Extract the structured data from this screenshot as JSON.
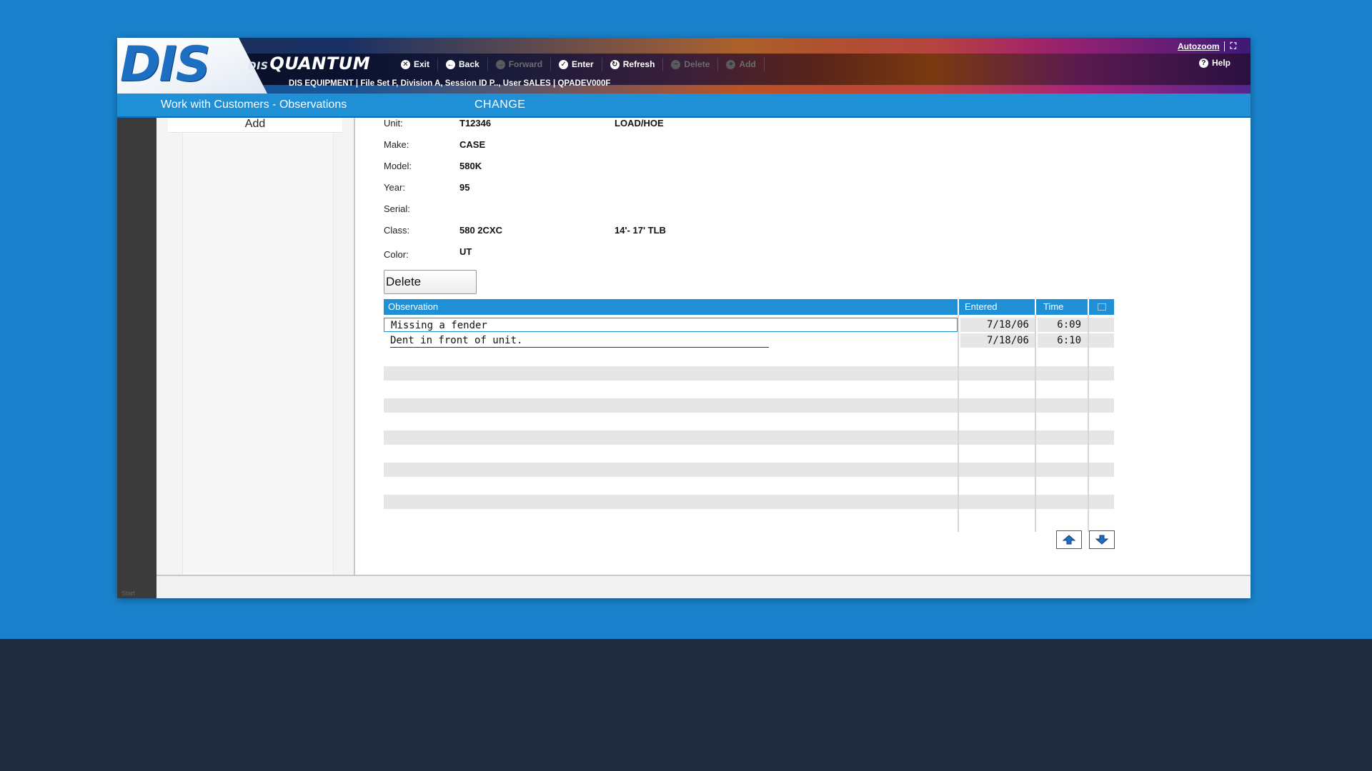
{
  "app": {
    "logo": "DIS",
    "brand_prefix": "DIS",
    "brand_name": "QUANTUM",
    "info_line": "DIS EQUIPMENT | File Set F, Division A, Session ID P.., User SALES | QPADEV000F",
    "autozoom_label": "Autozoom",
    "help_label": "Help"
  },
  "toolbar": [
    {
      "label": "Exit",
      "icon": "x-circle-icon",
      "glyph": "✕",
      "enabled": true
    },
    {
      "label": "Back",
      "icon": "back-icon",
      "glyph": "←",
      "enabled": true
    },
    {
      "label": "Forward",
      "icon": "forward-icon",
      "glyph": "→",
      "enabled": false
    },
    {
      "label": "Enter",
      "icon": "check-icon",
      "glyph": "✓",
      "enabled": true
    },
    {
      "label": "Refresh",
      "icon": "refresh-icon",
      "glyph": "↻",
      "enabled": true
    },
    {
      "label": "Delete",
      "icon": "minus-icon",
      "glyph": "−",
      "enabled": false
    },
    {
      "label": "Add",
      "icon": "plus-icon",
      "glyph": "+",
      "enabled": false
    }
  ],
  "titlebar": {
    "screen_title": "Work with Customers - Observations",
    "mode": "CHANGE"
  },
  "side_menu": {
    "items": [
      "Add"
    ]
  },
  "bottom_tiny": "Start",
  "unit": {
    "unit_label": "Unit:",
    "unit_value": "T12346",
    "unit_desc": "LOAD/HOE",
    "make_label": "Make:",
    "make_value": "CASE",
    "model_label": "Model:",
    "model_value": "580K",
    "year_label": "Year:",
    "year_value": "95",
    "serial_label": "Serial:",
    "serial_value": "",
    "class_label": "Class:",
    "class_value": "580 2CXC",
    "class_desc": "14'- 17' TLB",
    "color_label": "Color:",
    "color_value": "UT"
  },
  "delete_button": "Delete",
  "grid": {
    "columns": [
      "Observation",
      "Entered",
      "Time"
    ],
    "rows": [
      {
        "observation": "Missing a fender",
        "entered": "7/18/06",
        "time": "6:09"
      },
      {
        "observation": "Dent in front of unit.",
        "entered": "7/18/06",
        "time": "6:10"
      }
    ]
  },
  "colors": {
    "accent": "#1f8fd6",
    "background": "#1a82cc",
    "page_bottom": "#1f2a3d"
  }
}
